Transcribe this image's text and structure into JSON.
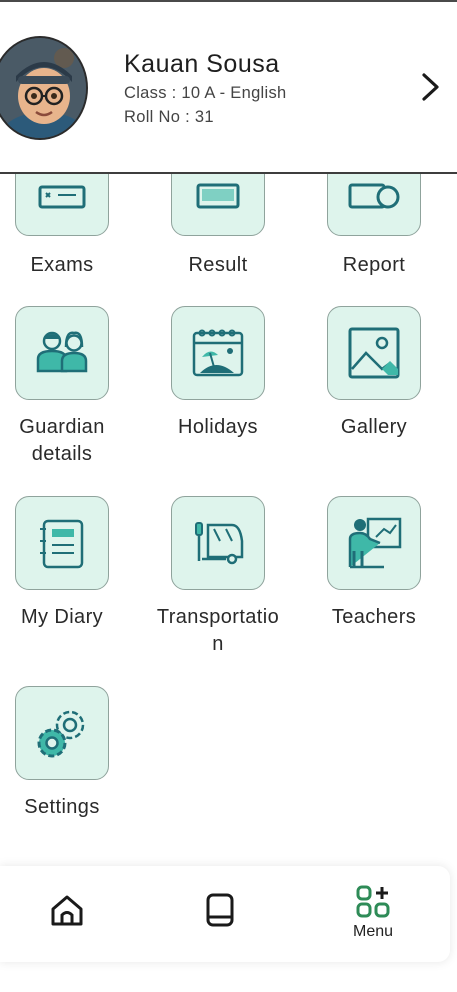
{
  "profile": {
    "name": "Kauan Sousa",
    "class_line": "Class : 10 A - English",
    "roll_line": "Roll No : 31"
  },
  "grid": {
    "items": [
      {
        "label": "Exams",
        "icon": "exam-icon"
      },
      {
        "label": "Result",
        "icon": "result-icon"
      },
      {
        "label": "Report",
        "icon": "report-icon"
      },
      {
        "label": "Guardian details",
        "line1": "Guardian",
        "line2": "details",
        "icon": "guardian-icon"
      },
      {
        "label": "Holidays",
        "icon": "holiday-icon"
      },
      {
        "label": "Gallery",
        "icon": "gallery-icon"
      },
      {
        "label": "My Diary",
        "icon": "diary-icon"
      },
      {
        "label": "Transportation",
        "line1": "Transportatio",
        "line2": "n",
        "icon": "bus-icon"
      },
      {
        "label": "Teachers",
        "icon": "teacher-icon"
      },
      {
        "label": "Settings",
        "icon": "settings-icon"
      }
    ]
  },
  "bottom_nav": {
    "home_icon": "home-icon",
    "book_icon": "book-icon",
    "menu_label": "Menu",
    "menu_icon": "menu-grid-icon"
  },
  "colors": {
    "tile_bg": "#def4ec",
    "icon_teal": "#1f6e77",
    "icon_light": "#3fb8a8",
    "menu_green": "#2e8b57"
  }
}
